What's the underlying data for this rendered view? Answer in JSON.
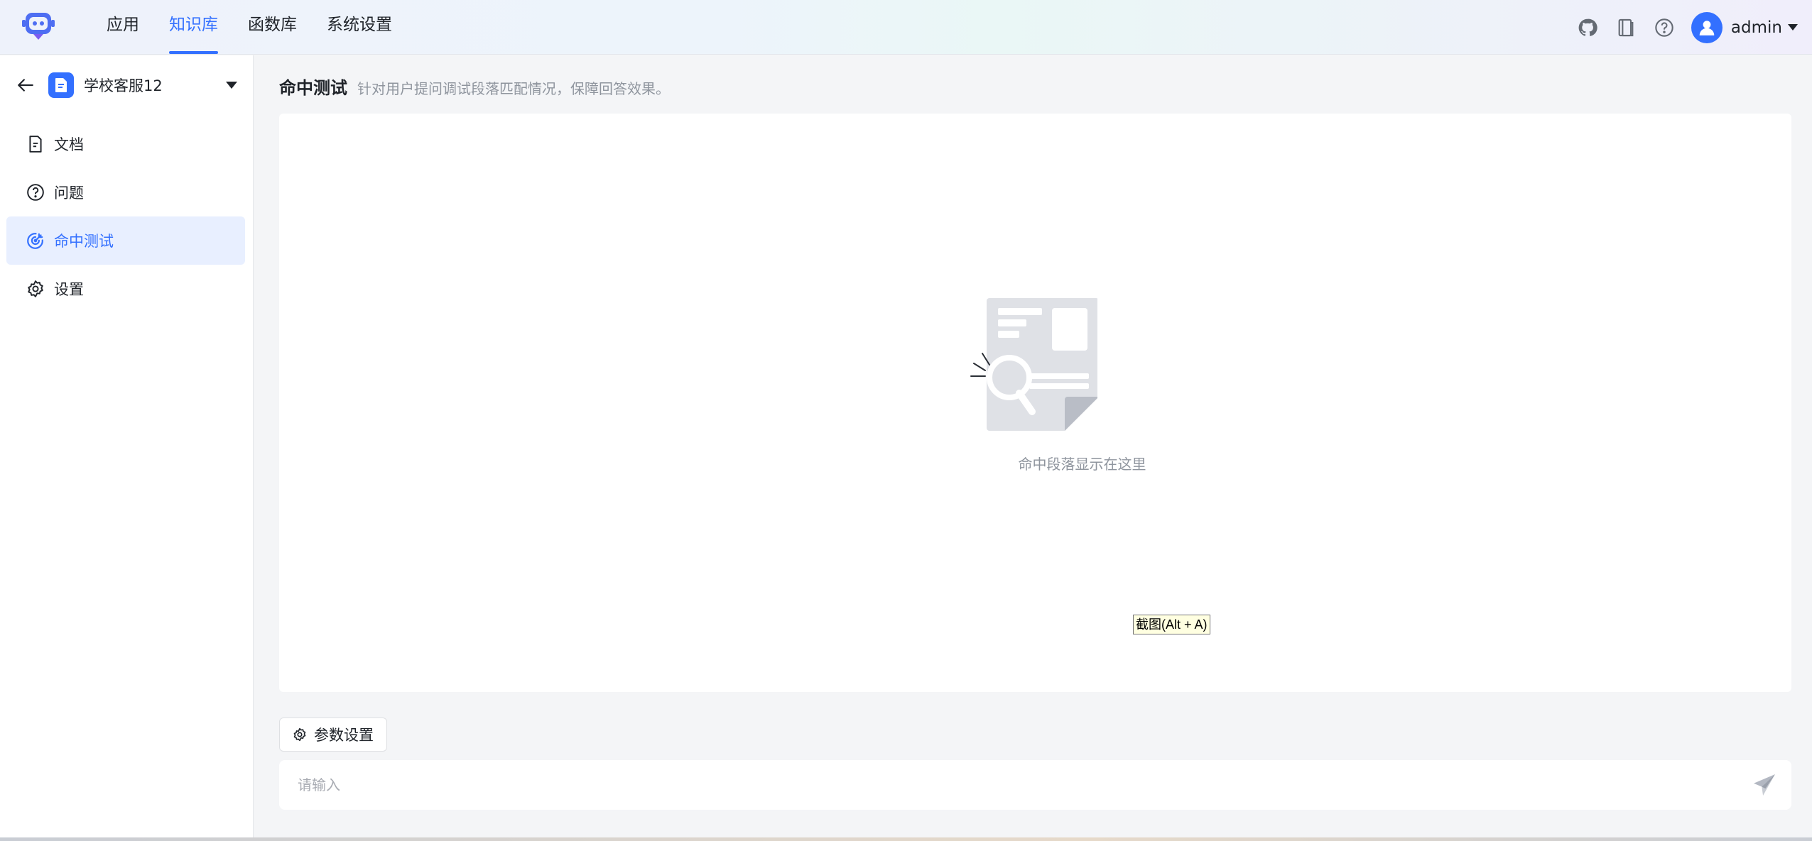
{
  "header": {
    "logo_icon": "robot-logo-icon",
    "nav": [
      {
        "label": "应用",
        "active": false
      },
      {
        "label": "知识库",
        "active": true
      },
      {
        "label": "函数库",
        "active": false
      },
      {
        "label": "系统设置",
        "active": false
      }
    ],
    "icons": [
      "github-icon",
      "book-icon",
      "help-icon"
    ],
    "user": {
      "name": "admin",
      "avatar_icon": "user-avatar-icon"
    },
    "accent_color": "#3370ff"
  },
  "sidebar": {
    "back_icon": "arrow-left-icon",
    "knowledge_base": {
      "name": "学校客服12",
      "icon": "document-badge-icon"
    },
    "items": [
      {
        "label": "文档",
        "icon": "file-icon",
        "active": false
      },
      {
        "label": "问题",
        "icon": "question-circle-icon",
        "active": false
      },
      {
        "label": "命中测试",
        "icon": "target-icon",
        "active": true
      },
      {
        "label": "设置",
        "icon": "gear-icon",
        "active": false
      }
    ]
  },
  "main": {
    "title": "命中测试",
    "description": "针对用户提问调试段落匹配情况，保障回答效果。",
    "empty": {
      "icon": "document-search-icon",
      "text": "命中段落显示在这里"
    },
    "tooltip": "截图(Alt + A)",
    "param_button": {
      "label": "参数设置",
      "icon": "gear-icon"
    },
    "input": {
      "placeholder": "请输入",
      "value": "",
      "send_icon": "send-icon"
    }
  }
}
